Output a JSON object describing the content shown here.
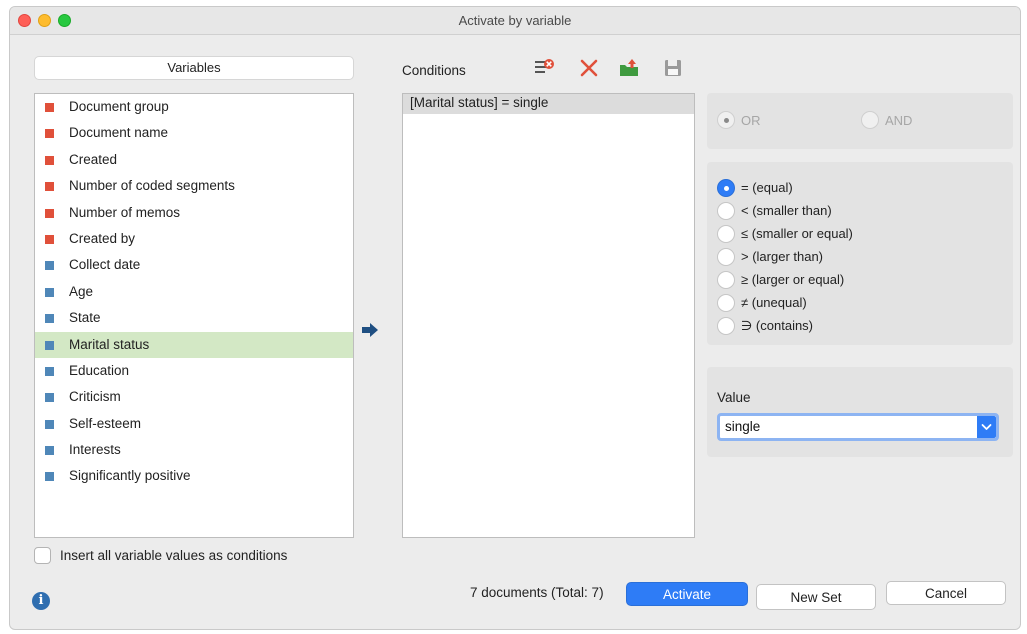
{
  "window": {
    "title": "Activate by variable"
  },
  "variables": {
    "header": "Variables",
    "items": [
      {
        "label": "Document group",
        "color": "#e0503a"
      },
      {
        "label": "Document name",
        "color": "#e0503a"
      },
      {
        "label": "Created",
        "color": "#e0503a"
      },
      {
        "label": "Number of coded segments",
        "color": "#e0503a"
      },
      {
        "label": "Number of memos",
        "color": "#e0503a"
      },
      {
        "label": "Created by",
        "color": "#e0503a"
      },
      {
        "label": "Collect date",
        "color": "#4f87b8"
      },
      {
        "label": "Age",
        "color": "#4f87b8"
      },
      {
        "label": "State",
        "color": "#4f87b8"
      },
      {
        "label": "Marital status",
        "color": "#4f87b8"
      },
      {
        "label": "Education",
        "color": "#4f87b8"
      },
      {
        "label": "Criticism",
        "color": "#4f87b8"
      },
      {
        "label": "Self-esteem",
        "color": "#4f87b8"
      },
      {
        "label": "Interests",
        "color": "#4f87b8"
      },
      {
        "label": "Significantly positive",
        "color": "#4f87b8"
      }
    ],
    "selected": "Marital status",
    "insert_all_label": "Insert all variable values as conditions"
  },
  "conditions": {
    "label": "Conditions",
    "items": [
      "[Marital status] = single"
    ]
  },
  "logic": {
    "or_label": "OR",
    "and_label": "AND",
    "selected": "OR"
  },
  "operators": {
    "items": [
      "= (equal)",
      "< (smaller than)",
      "≤ (smaller or equal)",
      "> (larger than)",
      "≥ (larger or equal)",
      "≠ (unequal)",
      "∋ (contains)"
    ],
    "selected": "= (equal)"
  },
  "value": {
    "label": "Value",
    "selected": "single"
  },
  "footer": {
    "count": "7 documents (Total: 7)",
    "activate": "Activate",
    "new_set": "New Set",
    "cancel": "Cancel"
  },
  "colors": {
    "accent": "#2e7cf6",
    "selected_row": "#d3e8c5"
  }
}
